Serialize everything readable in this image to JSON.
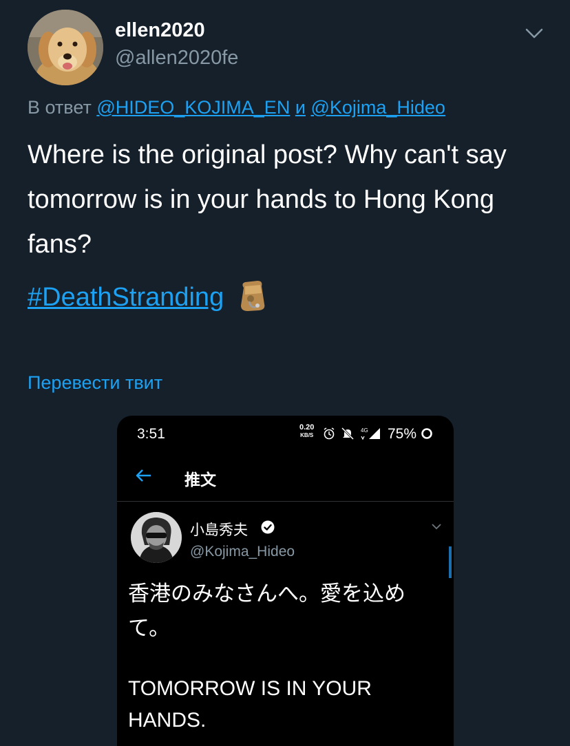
{
  "tweet": {
    "author_name": "ellen2020",
    "author_handle": "@allen2020fe",
    "reply_prefix": "В ответ",
    "reply_mention_1": "@HIDEO_KOJIMA_EN",
    "reply_conjunction": "и",
    "reply_mention_2": "@Kojima_Hideo",
    "text": "Where is the original post? Why can't say tomorrow is in your hands to Hong Kong fans?",
    "hashtag": "#DeathStranding",
    "translate_label": "Перевести твит",
    "icons": {
      "menu": "chevron-down-icon",
      "emoji": "bag-emoji-icon"
    }
  },
  "screenshot": {
    "status_bar": {
      "time": "3:51",
      "speed_value": "0.20",
      "speed_unit": "KB/S",
      "network": "4G",
      "battery": "75%"
    },
    "header_title": "推文",
    "author_name": "小島秀夫",
    "author_handle": "@Kojima_Hideo",
    "text_jp": "香港のみなさんへ。愛を込めて。",
    "text_en": "TOMORROW IS IN YOUR HANDS."
  },
  "colors": {
    "background": "#15202b",
    "accent": "#1da1f2",
    "secondary_text": "#8899a6",
    "phone_background": "#000000"
  }
}
